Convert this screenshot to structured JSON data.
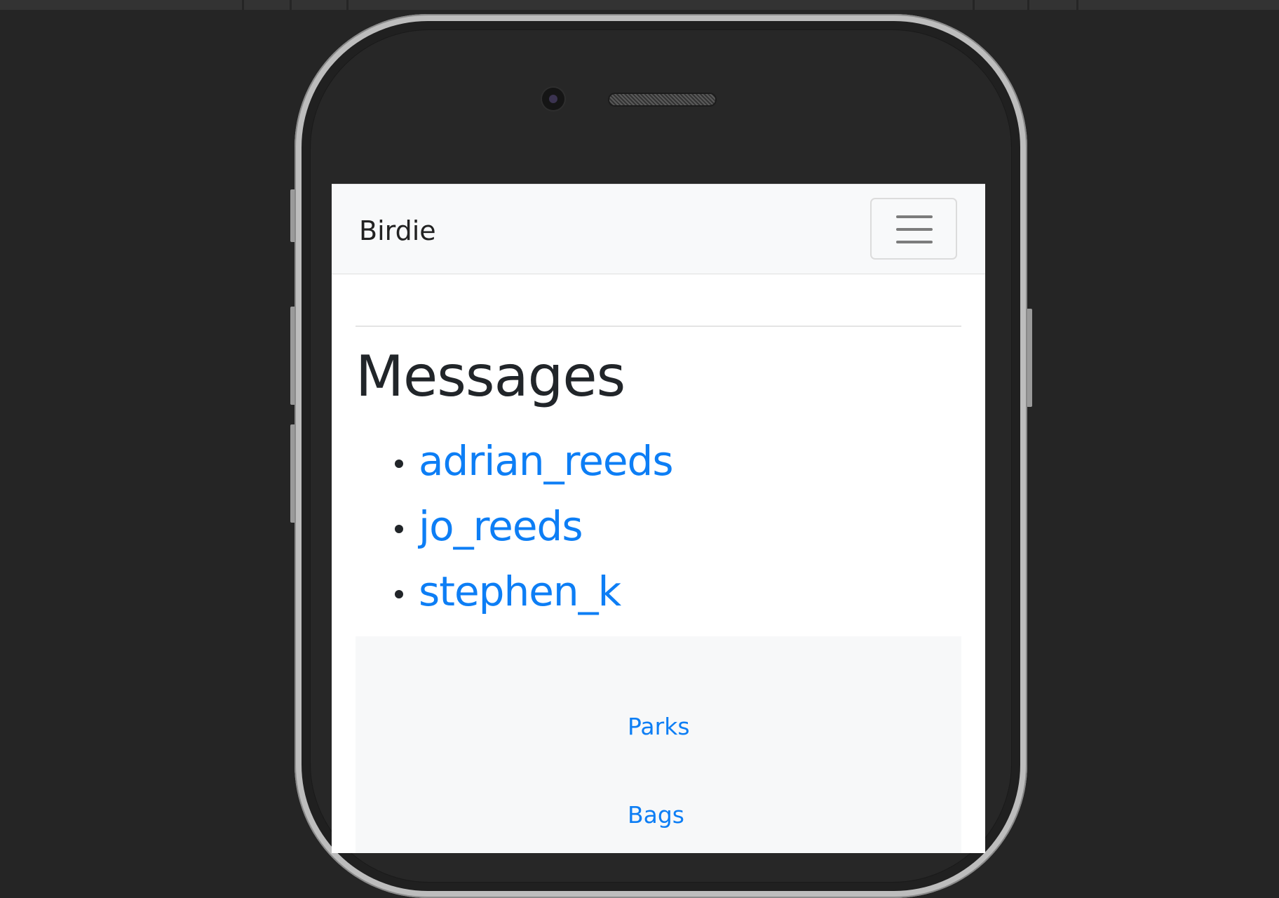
{
  "navbar": {
    "brand": "Birdie",
    "menu_icon": "hamburger-menu-icon"
  },
  "main": {
    "title": "Messages",
    "messages": [
      {
        "label": "adrian_reeds"
      },
      {
        "label": "jo_reeds"
      },
      {
        "label": "stephen_k"
      }
    ]
  },
  "footer_nav": {
    "links": [
      {
        "label": "Parks"
      },
      {
        "label": "Bags"
      }
    ]
  },
  "colors": {
    "link": "#0d7ef5",
    "navbar_bg": "#f8f9fa",
    "device_bg": "#252525"
  }
}
